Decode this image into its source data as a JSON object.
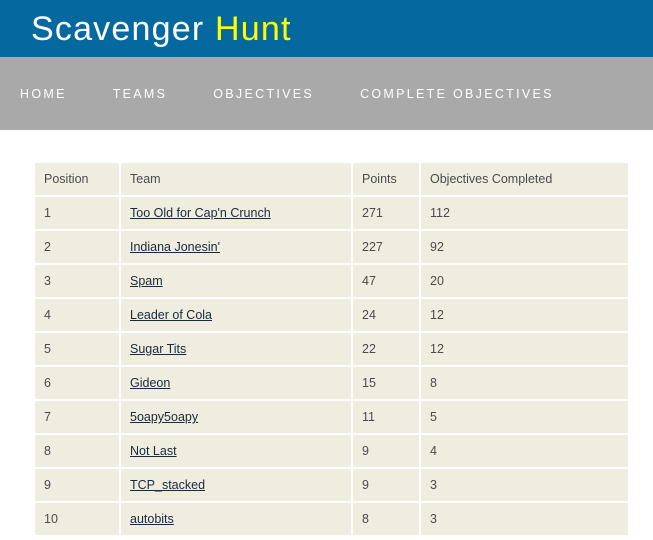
{
  "header": {
    "title_main": "Scavenger",
    "title_accent": "Hunt",
    "accent_color": "#ffff00",
    "background_color": "#0569a0"
  },
  "nav": {
    "background_color": "#a9a9a9",
    "items": [
      {
        "label": "HOME"
      },
      {
        "label": "TEAMS"
      },
      {
        "label": "OBJECTIVES"
      },
      {
        "label": "COMPLETE OBJECTIVES"
      }
    ]
  },
  "scoreboard": {
    "columns": [
      "Position",
      "Team",
      "Points",
      "Objectives Completed"
    ],
    "rows": [
      {
        "position": "1",
        "team": "Too Old for Cap'n Crunch",
        "points": "271",
        "objectives": "112"
      },
      {
        "position": "2",
        "team": "Indiana Jonesin'",
        "points": "227",
        "objectives": "92"
      },
      {
        "position": "3",
        "team": "Spam",
        "points": "47",
        "objectives": "20"
      },
      {
        "position": "4",
        "team": "Leader of Cola",
        "points": "24",
        "objectives": "12"
      },
      {
        "position": "5",
        "team": "Sugar Tits",
        "points": "22",
        "objectives": "12"
      },
      {
        "position": "6",
        "team": "Gideon",
        "points": "15",
        "objectives": "8"
      },
      {
        "position": "7",
        "team": "5oapy5oapy",
        "points": "11",
        "objectives": "5"
      },
      {
        "position": "8",
        "team": "Not Last",
        "points": "9",
        "objectives": "4"
      },
      {
        "position": "9",
        "team": "TCP_stacked",
        "points": "9",
        "objectives": "3"
      },
      {
        "position": "10",
        "team": "autobits",
        "points": "8",
        "objectives": "3"
      }
    ]
  }
}
